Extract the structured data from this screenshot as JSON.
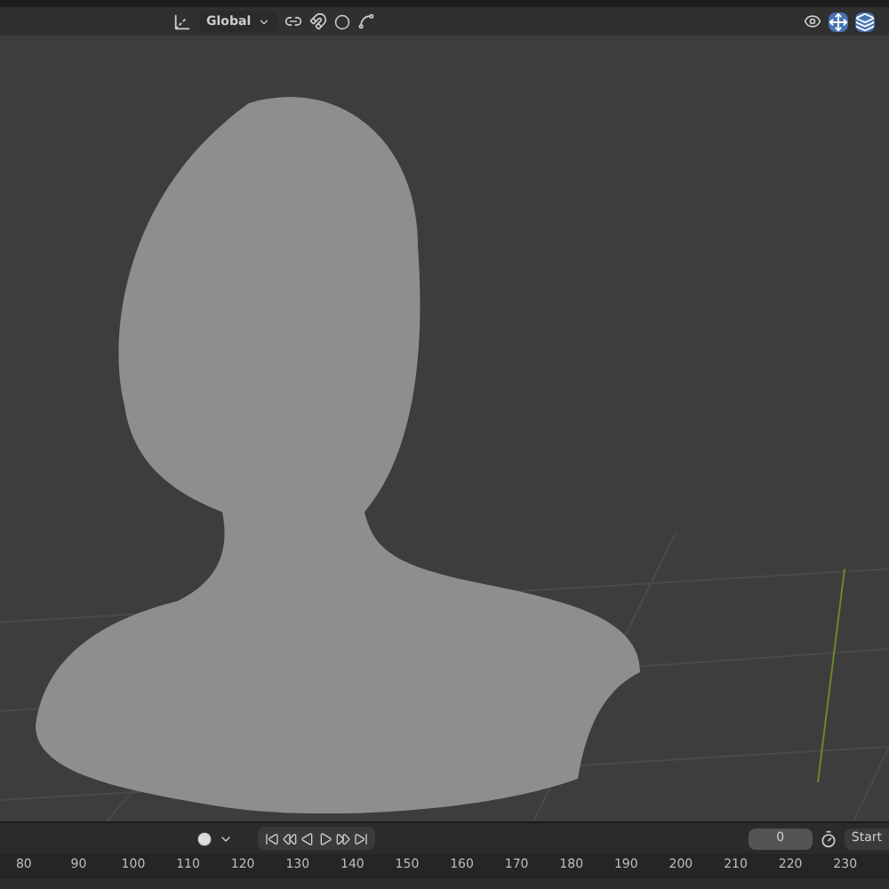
{
  "header": {
    "orientation": "Global"
  },
  "timeline": {
    "current_frame": "0",
    "start_label": "Start",
    "ruler": [
      "80",
      "90",
      "100",
      "110",
      "120",
      "130",
      "140",
      "150",
      "160",
      "170",
      "180",
      "190",
      "200",
      "210",
      "220",
      "230"
    ]
  }
}
